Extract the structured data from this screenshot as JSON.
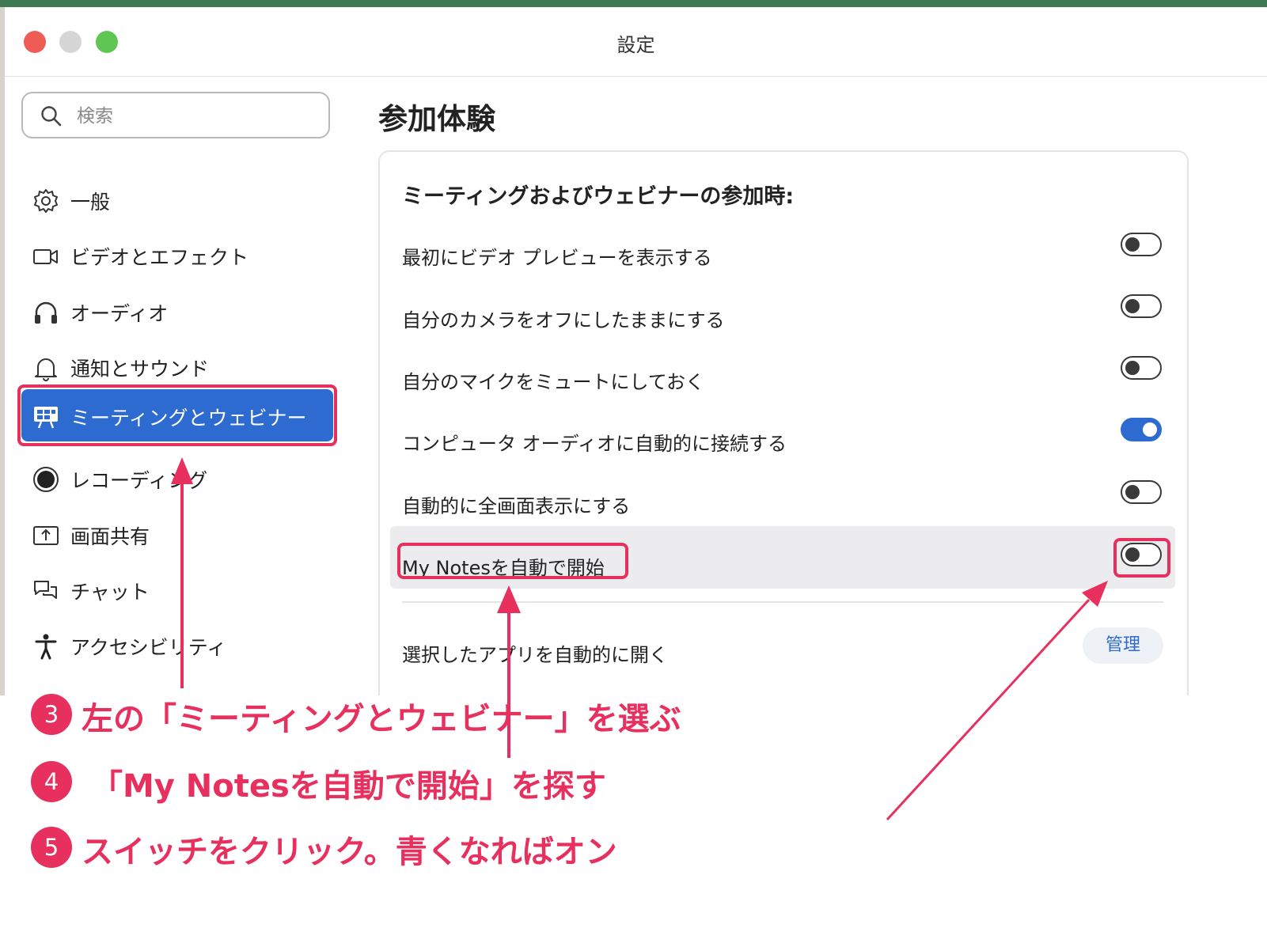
{
  "window": {
    "title": "設定"
  },
  "search": {
    "placeholder": "検索"
  },
  "sidebar": {
    "items": [
      {
        "label": "一般",
        "icon": "gear-icon"
      },
      {
        "label": "ビデオとエフェクト",
        "icon": "video-camera-icon"
      },
      {
        "label": "オーディオ",
        "icon": "headphones-icon"
      },
      {
        "label": "通知とサウンド",
        "icon": "bell-icon"
      },
      {
        "label": "ミーティングとウェビナー",
        "icon": "meeting-board-icon",
        "active": true
      },
      {
        "label": "レコーディング",
        "icon": "record-icon"
      },
      {
        "label": "画面共有",
        "icon": "share-screen-icon"
      },
      {
        "label": "チャット",
        "icon": "chat-bubbles-icon"
      },
      {
        "label": "アクセシビリティ",
        "icon": "accessibility-icon"
      }
    ]
  },
  "main": {
    "title": "参加体験",
    "section_heading": "ミーティングおよびウェビナーの参加時:",
    "settings": [
      {
        "label": "最初にビデオ プレビューを表示する",
        "on": false
      },
      {
        "label": "自分のカメラをオフにしたままにする",
        "on": false
      },
      {
        "label": "自分のマイクをミュートにしておく",
        "on": false
      },
      {
        "label": "コンピュータ オーディオに自動的に接続する",
        "on": true
      },
      {
        "label": "自動的に全画面表示にする",
        "on": false
      },
      {
        "label": "My Notesを自動で開始",
        "on": false
      }
    ],
    "apps_row": {
      "label": "選択したアプリを自動的に開く",
      "button": "管理"
    }
  },
  "annotations": {
    "accent_color": "#e8305f",
    "steps": [
      {
        "number": "3",
        "text": "左の「ミーティングとウェビナー」を選ぶ"
      },
      {
        "number": "4",
        "text": "「My Notesを自動で開始」を探す"
      },
      {
        "number": "5",
        "text": "スイッチをクリック。青くなればオン"
      }
    ]
  },
  "colors": {
    "accent_blue": "#2d6bd1",
    "toggle_on": "#2d6bd1"
  }
}
